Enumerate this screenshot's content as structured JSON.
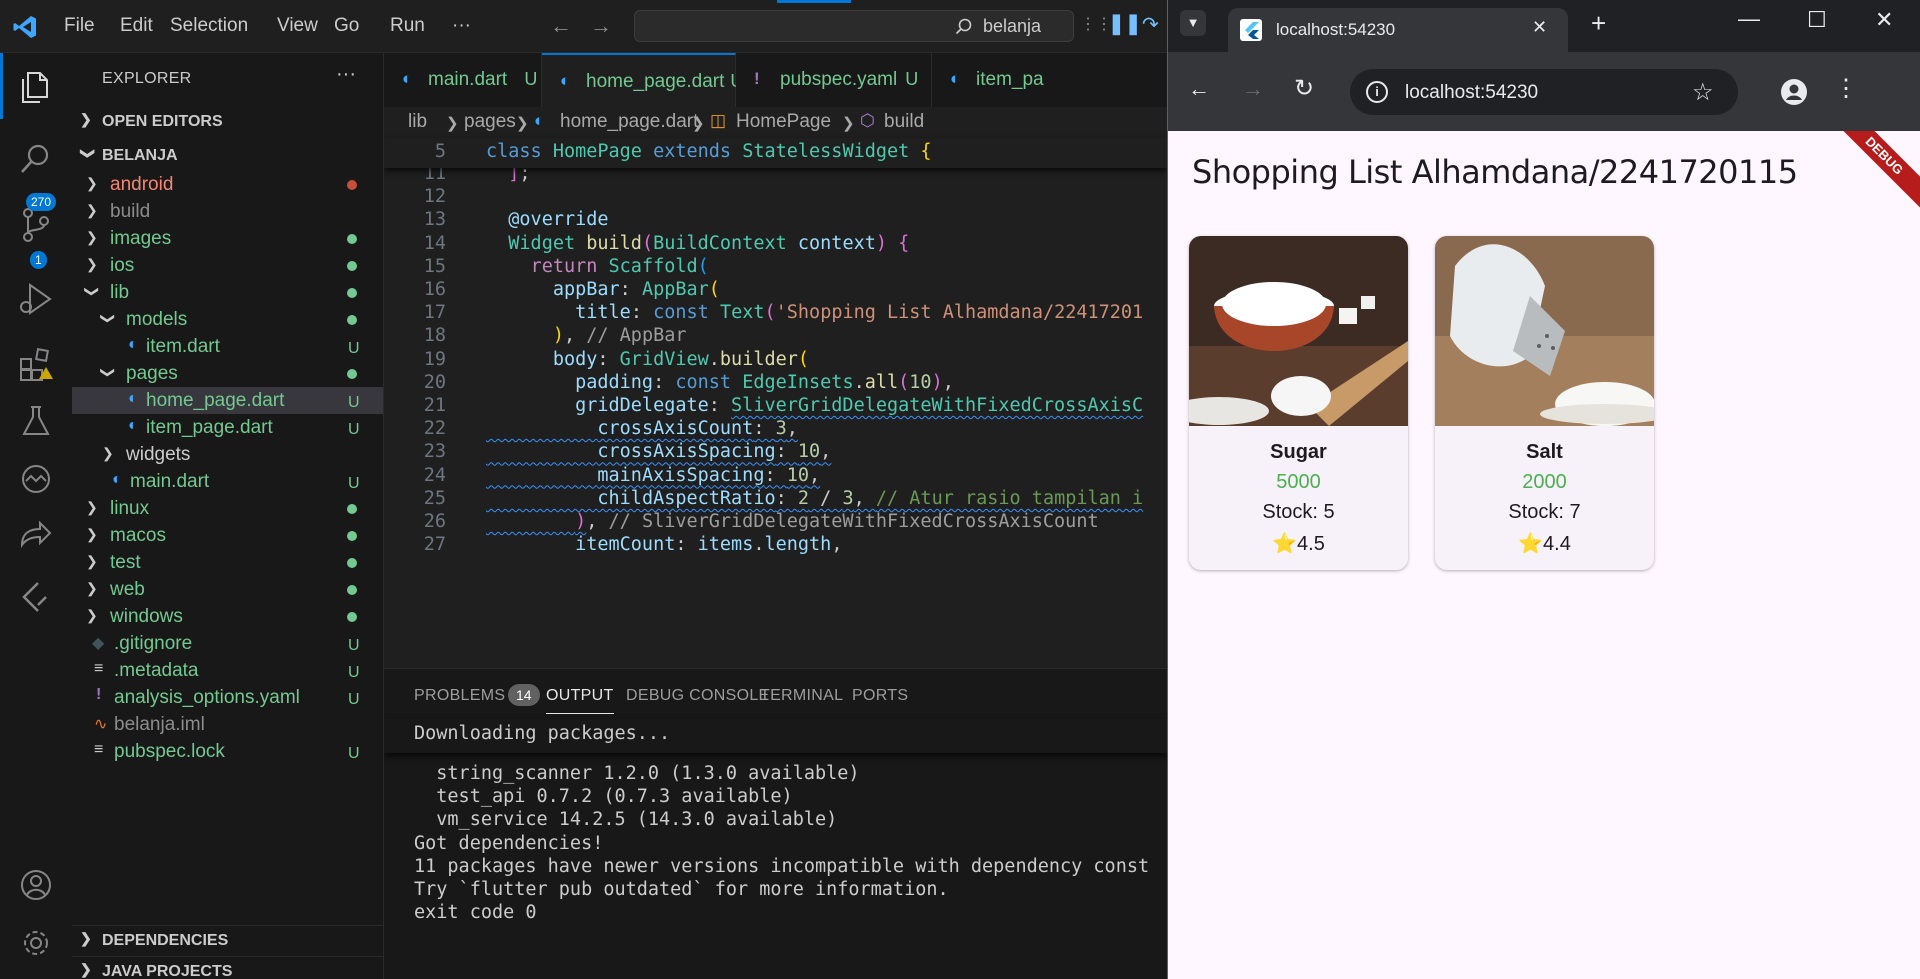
{
  "vscode": {
    "menu": [
      "File",
      "Edit",
      "Selection",
      "View",
      "Go",
      "Run",
      "···"
    ],
    "search_text": "belanja",
    "activity": {
      "scm_badge": "270",
      "debug_badge": "1"
    },
    "explorer": {
      "title": "EXPLORER",
      "open_editors": "OPEN EDITORS",
      "project": "BELANJA",
      "items": [
        {
          "label": "android",
          "type": "folder",
          "depth": 0,
          "status": "dot",
          "color": "#f48771",
          "dot": "#c74e39"
        },
        {
          "label": "build",
          "type": "folder",
          "depth": 0,
          "status": "",
          "color": "#8c8c8c"
        },
        {
          "label": "images",
          "type": "folder",
          "depth": 0,
          "status": "dot",
          "color": "#73c991",
          "dot": "#73c991"
        },
        {
          "label": "ios",
          "type": "folder",
          "depth": 0,
          "status": "dot",
          "color": "#73c991",
          "dot": "#73c991"
        },
        {
          "label": "lib",
          "type": "folder-open",
          "depth": 0,
          "status": "dot",
          "color": "#73c991",
          "dot": "#73c991"
        },
        {
          "label": "models",
          "type": "folder-open",
          "depth": 1,
          "status": "dot",
          "color": "#73c991",
          "dot": "#73c991"
        },
        {
          "label": "item.dart",
          "type": "dart",
          "depth": 2,
          "status": "U",
          "color": "#73c991"
        },
        {
          "label": "pages",
          "type": "folder-open",
          "depth": 1,
          "status": "dot",
          "color": "#73c991",
          "dot": "#73c991"
        },
        {
          "label": "home_page.dart",
          "type": "dart",
          "depth": 2,
          "status": "U",
          "color": "#73c991",
          "selected": true
        },
        {
          "label": "item_page.dart",
          "type": "dart",
          "depth": 2,
          "status": "U",
          "color": "#73c991"
        },
        {
          "label": "widgets",
          "type": "folder",
          "depth": 1,
          "status": "",
          "color": "#cccccc"
        },
        {
          "label": "main.dart",
          "type": "dart",
          "depth": 1,
          "status": "U",
          "color": "#73c991"
        },
        {
          "label": "linux",
          "type": "folder",
          "depth": 0,
          "status": "dot",
          "color": "#73c991",
          "dot": "#73c991"
        },
        {
          "label": "macos",
          "type": "folder",
          "depth": 0,
          "status": "dot",
          "color": "#73c991",
          "dot": "#73c991"
        },
        {
          "label": "test",
          "type": "folder",
          "depth": 0,
          "status": "dot",
          "color": "#73c991",
          "dot": "#73c991"
        },
        {
          "label": "web",
          "type": "folder",
          "depth": 0,
          "status": "dot",
          "color": "#73c991",
          "dot": "#73c991"
        },
        {
          "label": "windows",
          "type": "folder",
          "depth": 0,
          "status": "dot",
          "color": "#73c991",
          "dot": "#73c991"
        },
        {
          "label": ".gitignore",
          "type": "git",
          "depth": 0,
          "status": "U",
          "color": "#73c991"
        },
        {
          "label": ".metadata",
          "type": "lines",
          "depth": 0,
          "status": "U",
          "color": "#73c991"
        },
        {
          "label": "analysis_options.yaml",
          "type": "yaml",
          "depth": 0,
          "status": "U",
          "color": "#73c991"
        },
        {
          "label": "belanja.iml",
          "type": "rss",
          "depth": 0,
          "status": "",
          "color": "#8c8c8c"
        },
        {
          "label": "pubspec.lock",
          "type": "lines",
          "depth": 0,
          "status": "U",
          "color": "#73c991"
        }
      ],
      "dependencies": "DEPENDENCIES",
      "java_projects": "JAVA PROJECTS"
    },
    "tabs": [
      {
        "label": "main.dart",
        "suffix": "U",
        "icon": "dart",
        "active": false
      },
      {
        "label": "home_page.dart",
        "suffix": "U",
        "icon": "dart",
        "active": true
      },
      {
        "label": "pubspec.yaml",
        "suffix": "U",
        "icon": "yaml",
        "active": false
      },
      {
        "label": "item_pa",
        "suffix": "",
        "icon": "dart",
        "active": false
      }
    ],
    "breadcrumb": [
      "lib",
      "pages",
      "home_page.dart",
      "HomePage",
      "build"
    ],
    "sticky": {
      "num": "5",
      "html": "<span class='kw'>class</span> <span class='cls'>HomePage</span> <span class='kw'>extends</span> <span class='cls'>StatelessWidget</span> <span class='br1'>{</span>"
    },
    "code": [
      {
        "num": "11",
        "html": "  <span class='br2'>]</span>;"
      },
      {
        "num": "12",
        "html": ""
      },
      {
        "num": "13",
        "html": "  <span class='prop'>@override</span>"
      },
      {
        "num": "14",
        "html": "  <span class='cls'>Widget</span> <span class='fn'>build</span><span class='br2'>(</span><span class='cls'>BuildContext</span> <span class='prop'>context</span><span class='br2'>)</span> <span class='br2'>{</span>"
      },
      {
        "num": "15",
        "html": "    <span class='pur'>return</span> <span class='cls'>Scaffold</span><span class='br3'>(</span>"
      },
      {
        "num": "16",
        "html": "      <span class='prop'>appBar</span>: <span class='cls'>AppBar</span><span class='br1'>(</span>"
      },
      {
        "num": "17",
        "html": "        <span class='prop'>title</span>: <span class='kw'>const</span> <span class='cls'>Text</span><span class='br2'>(</span><span class='str'>'Shopping List Alhamdana/22417201</span>"
      },
      {
        "num": "18",
        "html": "      <span class='br1'>)</span>, <span class='gr'>// AppBar</span>"
      },
      {
        "num": "19",
        "html": "      <span class='prop'>body</span>: <span class='cls'>GridView</span>.<span class='fn'>builder</span><span class='br1'>(</span>"
      },
      {
        "num": "20",
        "html": "        <span class='prop'>padding</span>: <span class='kw'>const</span> <span class='cls'>EdgeInsets</span>.<span class='fn'>all</span><span class='br2'>(</span><span class='num'>10</span><span class='br2'>)</span>,"
      },
      {
        "num": "21",
        "html": "        <span class='prop'>gridDelegate</span>: <span class='cls squig'>SliverGridDelegateWithFixedCrossAxisC</span>"
      },
      {
        "num": "22",
        "html": "<span class='squig'>          <span class='prop'>crossAxisCount</span>: <span class='num'>3</span>,</span>"
      },
      {
        "num": "23",
        "html": "<span class='squig'>          <span class='prop'>crossAxisSpacing</span>: <span class='num'>10</span>,</span>"
      },
      {
        "num": "24",
        "html": "<span class='squig'>          <span class='prop'>mainAxisSpacing</span>: <span class='num'>10</span>,</span>"
      },
      {
        "num": "25",
        "html": "<span class='squig'>          <span class='prop'>childAspectRatio</span>: <span class='num'>2</span> / <span class='num'>3</span>, <span class='cmt'>// Atur rasio tampilan i</span></span>"
      },
      {
        "num": "26",
        "html": "<span class='squig'>        <span class='br2'>)</span></span>, <span class='gr'>// SliverGridDelegateWithFixedCrossAxisCount</span>"
      },
      {
        "num": "27",
        "html": "        <span class='prop'>itemCount</span>: <span class='prop'>items</span>.<span class='prop'>length</span>,"
      }
    ],
    "panel": {
      "tabs": [
        "PROBLEMS",
        "OUTPUT",
        "DEBUG CONSOLE",
        "TERMINAL",
        "PORTS"
      ],
      "problems_count": "14",
      "sticky": "Downloading packages...",
      "lines": [
        "  string_scanner 1.2.0 (1.3.0 available)",
        "  test_api 0.7.2 (0.7.3 available)",
        "  vm_service 14.2.5 (14.3.0 available)",
        "Got dependencies!",
        "11 packages have newer versions incompatible with dependency const",
        "Try `flutter pub outdated` for more information.",
        "exit code 0"
      ]
    }
  },
  "browser": {
    "tab_title": "localhost:54230",
    "url": "localhost:54230",
    "app_title": "Shopping List Alhamdana/2241720115",
    "debug_banner": "DEBUG",
    "products": [
      {
        "name": "Sugar",
        "price": "5000",
        "stock": "Stock: 5",
        "rating": "4.5",
        "image": "sugar-bowl"
      },
      {
        "name": "Salt",
        "price": "2000",
        "stock": "Stock: 7",
        "rating": "4.4",
        "image": "salt-shaker"
      }
    ]
  }
}
